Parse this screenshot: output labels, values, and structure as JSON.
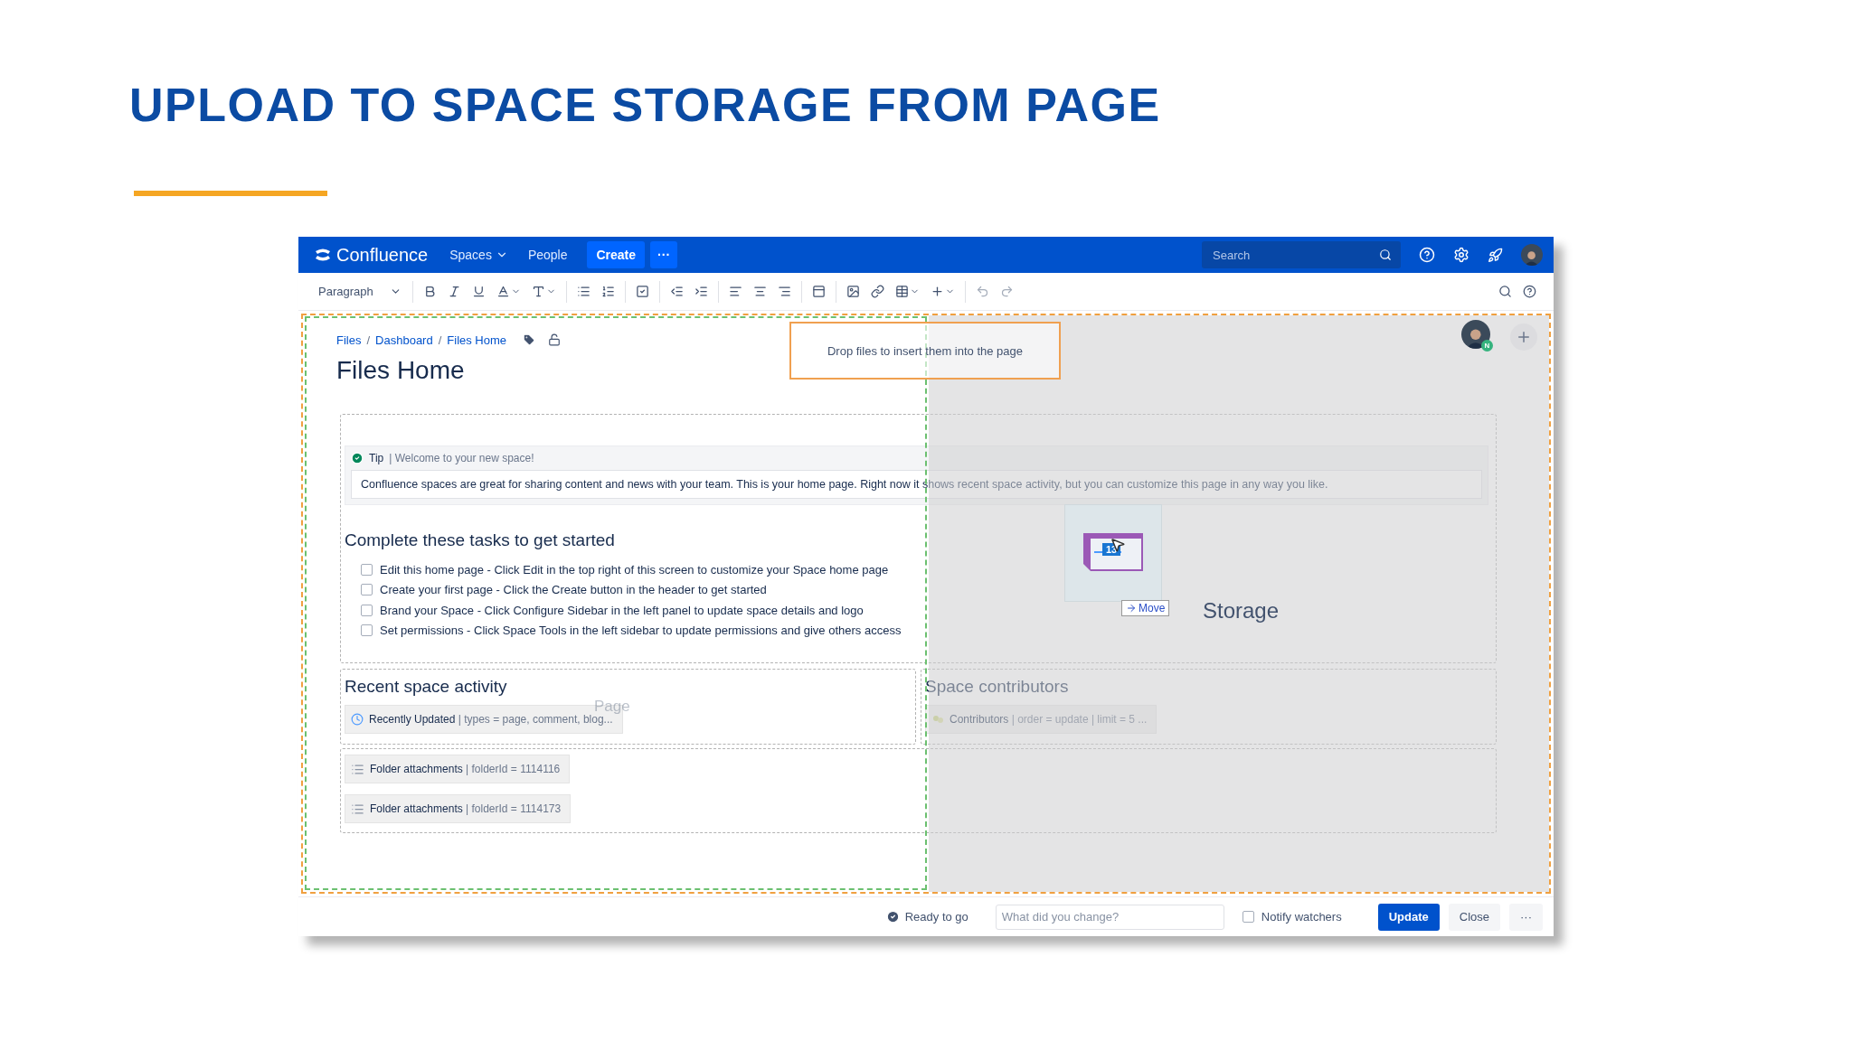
{
  "slide": {
    "title": "UPLOAD TO SPACE STORAGE FROM PAGE"
  },
  "nav": {
    "logo": "Confluence",
    "items": [
      {
        "label": "Spaces",
        "dropdown": true
      },
      {
        "label": "People",
        "dropdown": false
      }
    ],
    "create": "Create",
    "more": "···",
    "search": {
      "placeholder": "Search"
    }
  },
  "toolbar": {
    "style": "Paragraph"
  },
  "breadcrumbs": [
    "Files",
    "Dashboard",
    "Files Home"
  ],
  "breadcrumb_separator": "/",
  "page_title": "Files Home",
  "drop_hint": "Drop files to insert them into the page",
  "zones": {
    "page_label": "Page",
    "storage_label": "Storage"
  },
  "drag": {
    "badge": "13",
    "action": "Move"
  },
  "user": {
    "badge": "N"
  },
  "tip": {
    "title": "Tip",
    "subtitle": "| Welcome to your new space!",
    "body": "Confluence spaces are great for sharing content and news with your team. This is your home page. Right now it shows recent space activity, but you can customize this page in any way you like."
  },
  "tasks": {
    "heading": "Complete these tasks to get started",
    "items": [
      {
        "text": "Edit this home page - Click Edit in the top right of this screen to customize your Space home page",
        "checked": false
      },
      {
        "text": "Create your first page - Click the Create button in the header to get started",
        "checked": false
      },
      {
        "text": "Brand your Space - Click Configure Sidebar in the left panel to update space details and logo",
        "checked": false
      },
      {
        "text": "Set permissions - Click Space Tools in the left sidebar to update permissions and give others access",
        "checked": false
      }
    ]
  },
  "recent": {
    "heading": "Recent space activity",
    "macro": {
      "name": "Recently Updated",
      "params": "| types = page, comment, blog..."
    }
  },
  "contributors": {
    "heading": "Space contributors",
    "macro": {
      "name": "Contributors",
      "params": "| order = update | limit = 5 ..."
    }
  },
  "folders": [
    {
      "name": "Folder attachments",
      "params": "| folderId = 1114116"
    },
    {
      "name": "Folder attachments",
      "params": "| folderId = 1114173"
    }
  ],
  "footer": {
    "status": "Ready to go",
    "comment": {
      "placeholder": "What did you change?"
    },
    "notify": {
      "label": "Notify watchers",
      "checked": false
    },
    "buttons": [
      {
        "label": "Update",
        "kind": "primary"
      },
      {
        "label": "Close",
        "kind": "default"
      },
      {
        "label": "···",
        "kind": "more"
      }
    ]
  }
}
